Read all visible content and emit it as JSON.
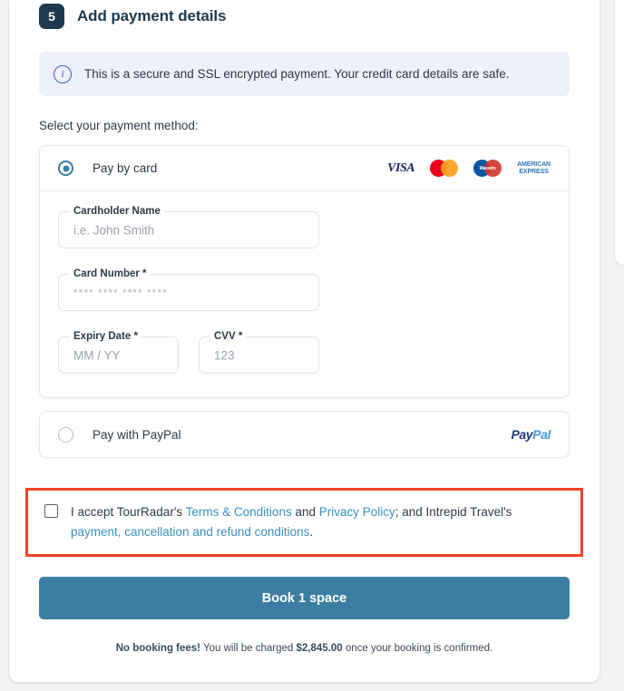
{
  "step": {
    "number": "5",
    "title": "Add payment details"
  },
  "info_banner": {
    "icon": "info-circle-icon",
    "text": "This is a secure and SSL encrypted payment. Your credit card details are safe."
  },
  "select_label": "Select your payment method:",
  "payment_methods": [
    {
      "id": "card",
      "label": "Pay by card",
      "selected": true,
      "logos": [
        "VISA",
        "Mastercard",
        "Maestro",
        "AMERICAN EXPRESS"
      ]
    },
    {
      "id": "paypal",
      "label": "Pay with PayPal",
      "selected": false,
      "logos": [
        "PayPal"
      ]
    }
  ],
  "logos": {
    "visa": "VISA",
    "maestro": "Maestro",
    "amex_line1": "AMERICAN",
    "amex_line2": "EXPRESS",
    "paypal_a": "Pay",
    "paypal_b": "Pal"
  },
  "card_form": {
    "cardholder": {
      "label": "Cardholder Name",
      "placeholder": "i.e. John Smith",
      "value": ""
    },
    "card_number": {
      "label": "Card Number *",
      "placeholder": "**** **** **** ****",
      "value": ""
    },
    "expiry": {
      "label": "Expiry Date *",
      "placeholder": "MM / YY",
      "value": ""
    },
    "cvv": {
      "label": "CVV *",
      "placeholder": "123",
      "value": ""
    }
  },
  "terms": {
    "checked": false,
    "prefix": "I accept TourRadar's ",
    "link1": "Terms & Conditions",
    "mid1": " and ",
    "link2": "Privacy Policy",
    "mid2": "; and Intrepid Travel's ",
    "link3": "payment, cancellation and refund conditions",
    "suffix": ".",
    "highlight_color": "#f04326"
  },
  "book_button": {
    "label": "Book 1 space",
    "color": "#3b7ea1"
  },
  "footer": {
    "bold_lead": "No booking fees!",
    "text_mid": " You will be charged ",
    "amount": "$2,845.00",
    "text_end": " once your booking is confirmed."
  }
}
